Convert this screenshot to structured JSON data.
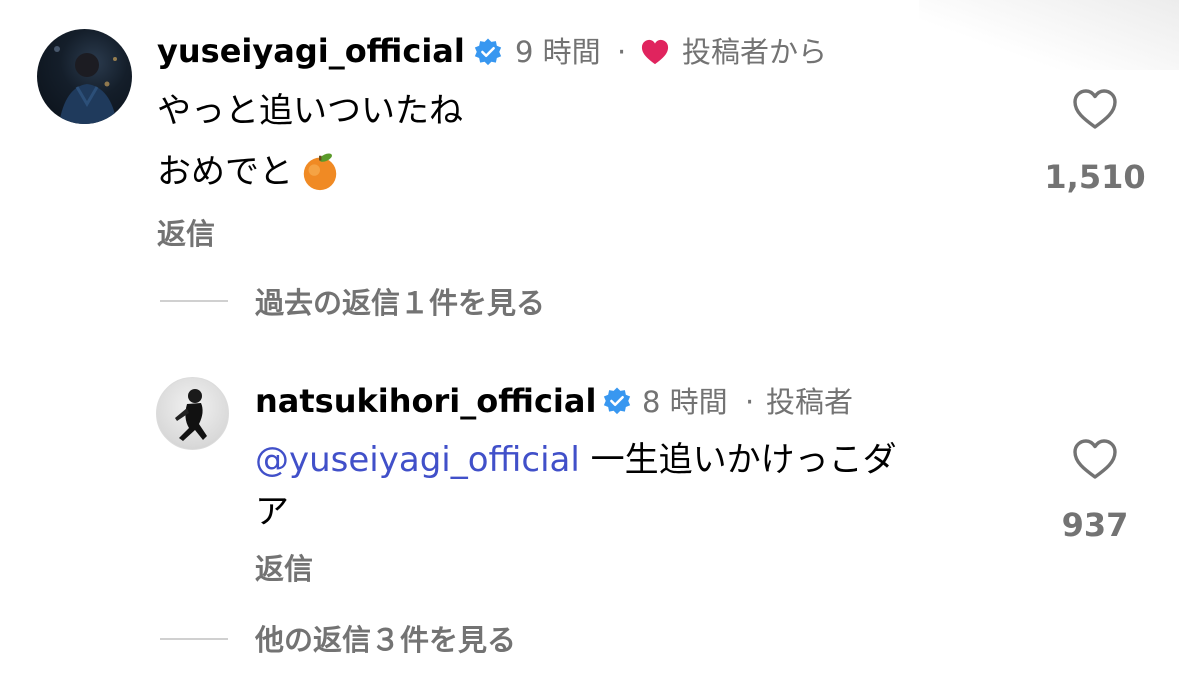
{
  "colors": {
    "meta_gray": "#737373",
    "verified_blue": "#3897f0",
    "heart_red": "#e0245e",
    "mention_blue": "#4150c9"
  },
  "comments": [
    {
      "username": "yuseiyagi_official",
      "time": "9 時間",
      "separator": "·",
      "creator_liked_label": "投稿者から",
      "lines": [
        "やっと追いついたね",
        "おめでと"
      ],
      "emoji": "tangerine-emoji",
      "reply_label": "返信",
      "like_count": "1,510",
      "view_replies_label": "過去の返信１件を見る"
    },
    {
      "username": "natsukihori_official",
      "time": "8 時間",
      "separator": "·",
      "author_label": "投稿者",
      "mention": "@yuseiyagi_official",
      "line1_rest": " 一生追いかけっこダ",
      "line2": "ア",
      "reply_label": "返信",
      "like_count": "937",
      "view_replies_label": "他の返信３件を見る"
    }
  ],
  "icons": {
    "verified": "verified-badge-icon",
    "heart": "heart-outline-icon",
    "creator_heart": "heart-filled-icon"
  }
}
